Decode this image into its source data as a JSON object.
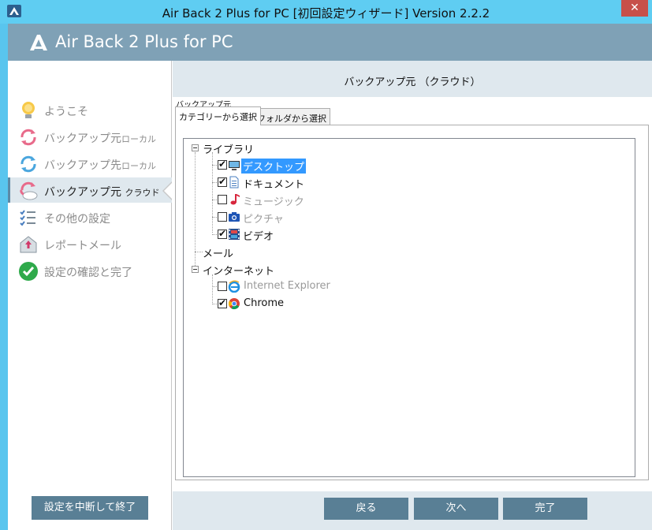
{
  "window": {
    "title": "Air Back 2 Plus for PC [初回設定ウィザード] Version 2.2.2",
    "close_label": "✕"
  },
  "header": {
    "title": "Air Back 2 Plus for PC"
  },
  "sidebar": {
    "items": [
      {
        "label": "ようこそ",
        "sub": "",
        "icon": "lightbulb-icon",
        "state": "inactive"
      },
      {
        "label": "バックアップ元",
        "sub": "ローカル",
        "icon": "sync-pink-icon",
        "state": "inactive"
      },
      {
        "label": "バックアップ先",
        "sub": "ローカル",
        "icon": "sync-blue-icon",
        "state": "inactive"
      },
      {
        "label": "バックアップ元",
        "sub": "クラウド",
        "icon": "cloud-sync-icon",
        "state": "active"
      },
      {
        "label": "その他の設定",
        "sub": "",
        "icon": "checklist-icon",
        "state": "inactive"
      },
      {
        "label": "レポートメール",
        "sub": "",
        "icon": "report-mail-icon",
        "state": "inactive"
      },
      {
        "label": "設定の確認と完了",
        "sub": "",
        "icon": "green-check-icon",
        "state": "inactive"
      }
    ],
    "quit_label": "設定を中断して終了"
  },
  "main": {
    "section_title": "バックアップ元 （クラウド）",
    "group_label": "バックアップ元",
    "tabs": [
      {
        "label": "カテゴリーから選択",
        "active": true
      },
      {
        "label": "フォルダから選択",
        "active": false
      }
    ],
    "tree": {
      "library": "ライブラリ",
      "desktop": "デスクトップ",
      "documents": "ドキュメント",
      "music": "ミュージック",
      "pictures": "ピクチャ",
      "video": "ビデオ",
      "mail": "メール",
      "internet": "インターネット",
      "ie": "Internet Explorer",
      "chrome": "Chrome"
    },
    "checked": {
      "desktop": true,
      "documents": true,
      "music": false,
      "pictures": false,
      "video": true,
      "ie": false,
      "chrome": true
    }
  },
  "footer": {
    "back_label": "戻る",
    "next_label": "次へ",
    "finish_label": "完了"
  },
  "colors": {
    "titlebar": "#5fcdf2",
    "header": "#7fa1b6",
    "button": "#597f95",
    "main_bg": "#dfe8ee",
    "selection": "#3399ff",
    "close": "#c7504a"
  }
}
